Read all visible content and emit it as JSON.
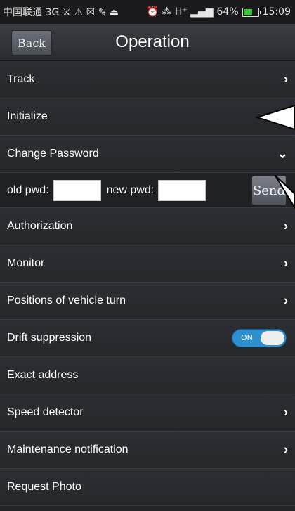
{
  "status_bar": {
    "carrier": "中国联通 3G ⚔ ⚠ ☒ ✎ ⏏",
    "network": "⏰ ⁂ H⁺ ▂▄▆",
    "battery_text": "64%",
    "battery_level": 0.64,
    "time": "15:09"
  },
  "header": {
    "back_label": "Back",
    "title": "Operation"
  },
  "menu": [
    {
      "label": "Track",
      "chevron": "›"
    },
    {
      "label": "Initialize",
      "chevron": ""
    },
    {
      "label": "Change Password",
      "chevron": "⌄"
    },
    {
      "label": "Authorization",
      "chevron": "›"
    },
    {
      "label": "Monitor",
      "chevron": "›"
    },
    {
      "label": "Positions of vehicle turn",
      "chevron": "›"
    },
    {
      "label": "Drift suppression",
      "chevron": ""
    },
    {
      "label": "Exact address",
      "chevron": ""
    },
    {
      "label": "Speed detector",
      "chevron": "›"
    },
    {
      "label": "Maintenance notification",
      "chevron": "›"
    },
    {
      "label": "Request Photo",
      "chevron": ""
    }
  ],
  "password": {
    "old_label": "old pwd:",
    "old_value": "",
    "new_label": "new pwd:",
    "new_value": "",
    "send_label": "Send"
  },
  "drift_toggle": {
    "state_label": "ON",
    "on": true
  },
  "colors": {
    "accent": "#2b8fd0",
    "background": "#232529",
    "header": "#2f3237"
  }
}
